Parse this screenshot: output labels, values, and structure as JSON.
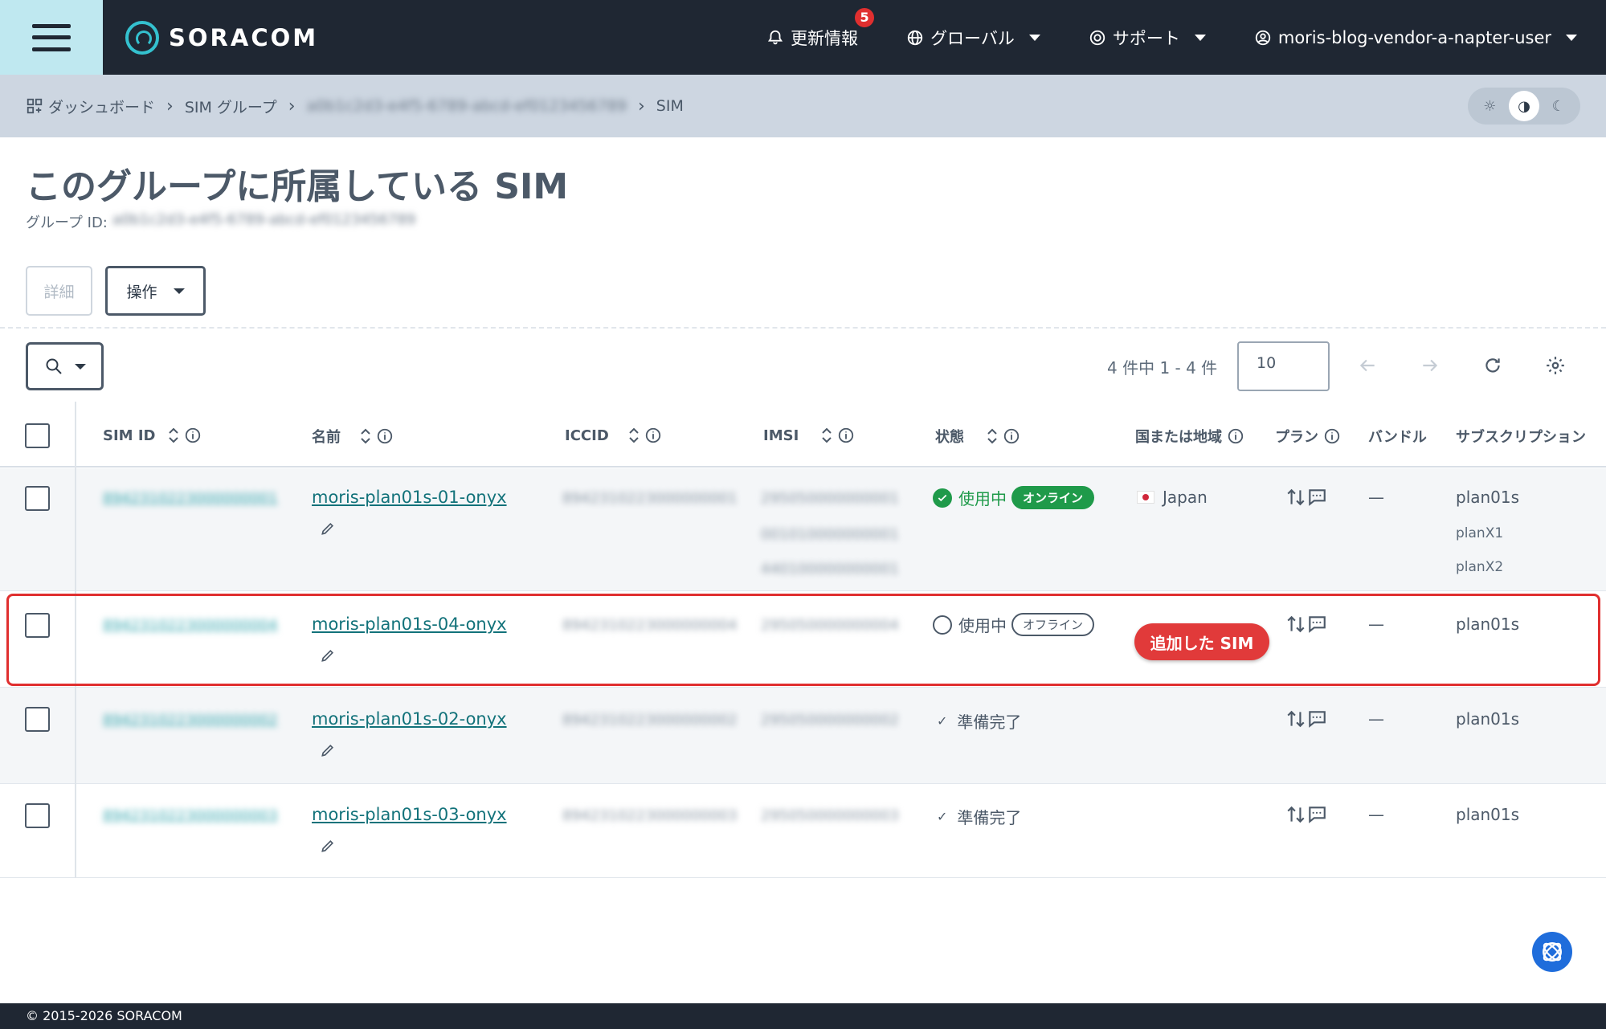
{
  "header": {
    "logo_text": "SORACOM",
    "updates_label": "更新情報",
    "updates_count": "5",
    "global_label": "グローバル",
    "support_label": "サポート",
    "user_label": "moris-blog-vendor-a-napter-user"
  },
  "breadcrumb": {
    "dashboard": "ダッシュボード",
    "sim_group": "SIM グループ",
    "group_id_blurred": "a0b1c2d3-e4f5-6789-abcd-ef0123456789",
    "sim": "SIM"
  },
  "page": {
    "title": "このグループに所属している SIM",
    "group_id_label": "グループ ID:",
    "group_id_blurred": "a0b1c2d3-e4f5-6789-abcd-ef0123456789"
  },
  "actions": {
    "details": "詳細",
    "operations": "操作"
  },
  "pagination": {
    "count_text": "4 件中 1 - 4 件",
    "per_page": "10"
  },
  "columns": {
    "sim_id": "SIM ID",
    "name": "名前",
    "iccid": "ICCID",
    "imsi": "IMSI",
    "status": "状態",
    "country": "国または地域",
    "plan": "プラン",
    "bundle": "バンドル",
    "subscription": "サブスクリプション"
  },
  "rows": [
    {
      "sim_id": "8942310223000000001",
      "name": "moris-plan01s-01-onyx",
      "iccid": "8942310223000000001",
      "imsi": [
        "295050000000001",
        "001010000000001",
        "440100000000001"
      ],
      "status": "使用中",
      "session": "オンライン",
      "country": "Japan",
      "bundle": "—",
      "subscriptions": [
        "plan01s",
        "planX1",
        "planX2"
      ]
    },
    {
      "sim_id": "8942310223000000004",
      "name": "moris-plan01s-04-onyx",
      "iccid": "8942310223000000004",
      "imsi": [
        "295050000000004"
      ],
      "status": "使用中",
      "session": "オフライン",
      "country": "",
      "bundle": "—",
      "subscriptions": [
        "plan01s"
      ],
      "annotation": "追加した SIM"
    },
    {
      "sim_id": "8942310223000000002",
      "name": "moris-plan01s-02-onyx",
      "iccid": "8942310223000000002",
      "imsi": [
        "295050000000002"
      ],
      "status": "準備完了",
      "country": "",
      "bundle": "—",
      "subscriptions": [
        "plan01s"
      ]
    },
    {
      "sim_id": "8942310223000000003",
      "name": "moris-plan01s-03-onyx",
      "iccid": "8942310223000000003",
      "imsi": [
        "295050000000003"
      ],
      "status": "準備完了",
      "country": "",
      "bundle": "—",
      "subscriptions": [
        "plan01s"
      ]
    }
  ],
  "footer": {
    "copyright": "© 2015-2026 SORACOM"
  },
  "colors": {
    "topbar": "#1f2733",
    "accent": "#34c1cf",
    "link": "#12727a",
    "online": "#1f9a4a",
    "highlight": "#e02f2f"
  },
  "icons": [
    "menu-icon",
    "bell-icon",
    "globe-icon",
    "support-icon",
    "user-icon",
    "dashboard-icon",
    "sun-icon",
    "contrast-icon",
    "moon-icon",
    "search-icon",
    "arrow-left-icon",
    "arrow-right-icon",
    "refresh-icon",
    "gear-icon",
    "sort-icon",
    "info-icon",
    "pencil-icon",
    "speed-class-icon",
    "sms-icon",
    "help-icon"
  ]
}
